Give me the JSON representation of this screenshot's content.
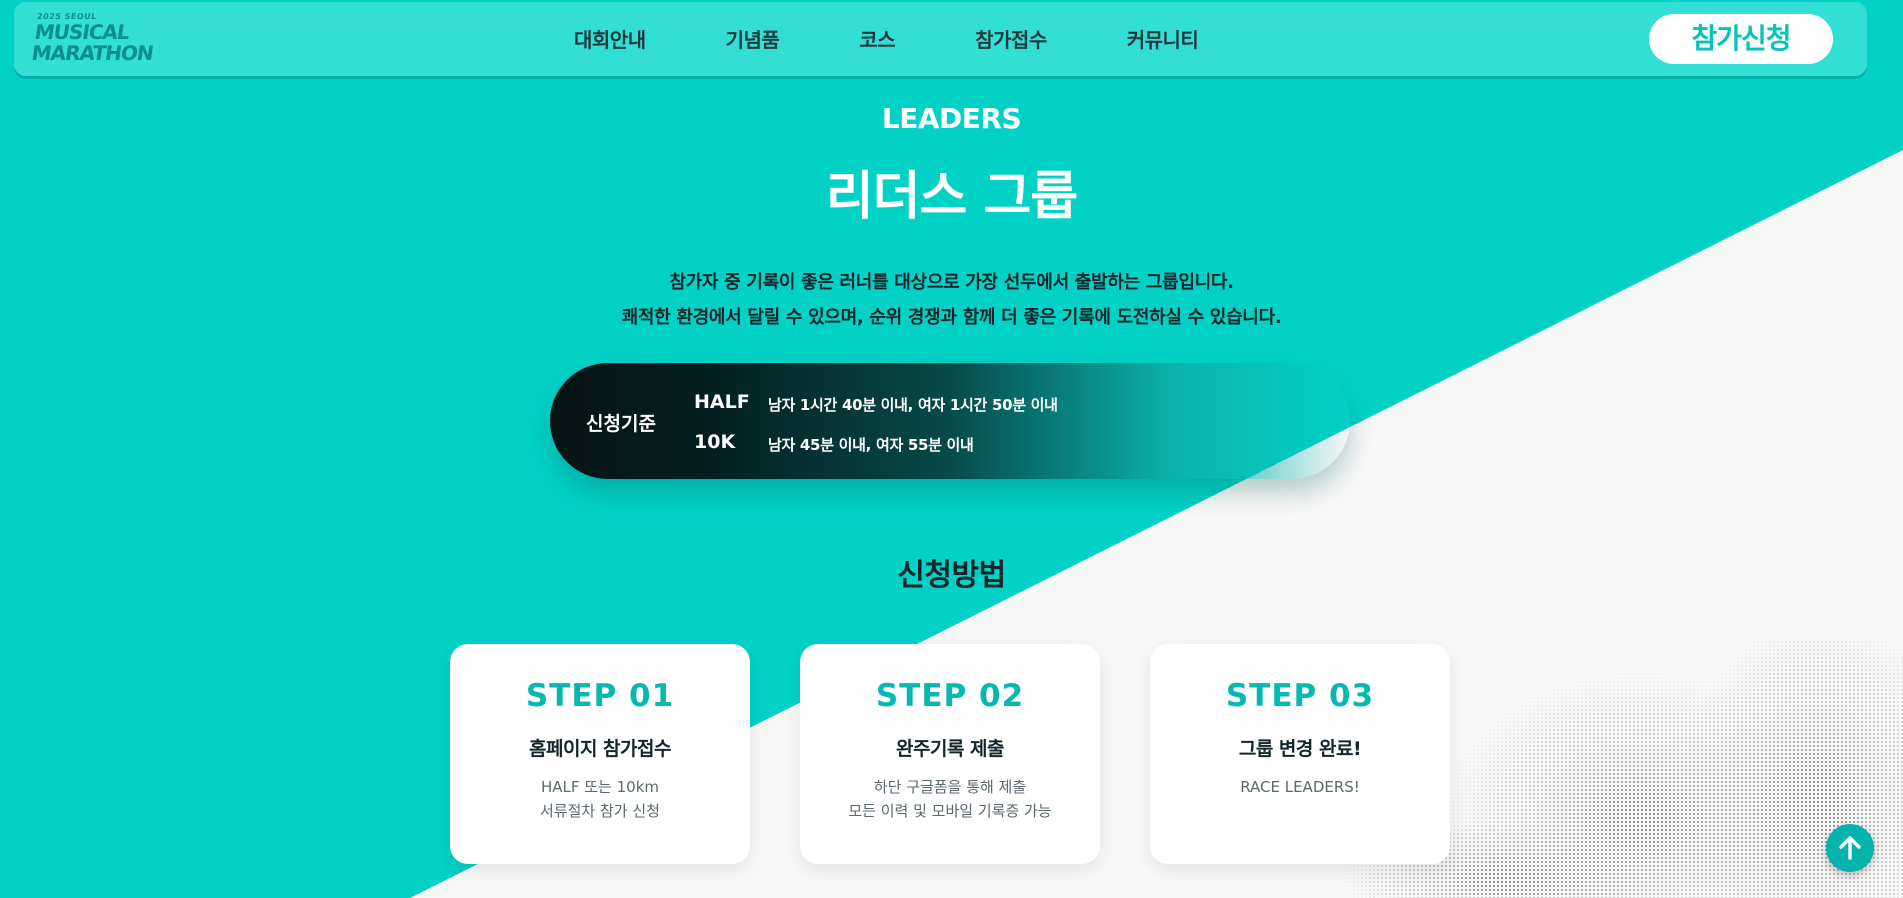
{
  "logo": {
    "line1": "2025 SEOUL",
    "line2": "MUSICAL",
    "line3": "MARATHON"
  },
  "nav": {
    "items": [
      "대회안내",
      "기념품",
      "코스",
      "참가접수",
      "커뮤니티"
    ]
  },
  "header": {
    "apply_label": "참가신청"
  },
  "hero": {
    "eyebrow": "LEADERS",
    "title": "리더스 그룹",
    "desc_line1": "참가자 중 기록이 좋은 러너를 대상으로 가장 선두에서 출발하는 그룹입니다.",
    "desc_line2": "쾌적한 환경에서 달릴 수 있으며, 순위 경쟁과 함께 더 좋은 기록에 도전하실 수 있습니다."
  },
  "criteria": {
    "label": "신청기준",
    "rows": [
      {
        "key": "HALF",
        "value": "남자 1시간 40분 이내, 여자 1시간 50분 이내"
      },
      {
        "key": "10K",
        "value": "남자 45분 이내, 여자 55분 이내"
      }
    ]
  },
  "method": {
    "title": "신청방법",
    "steps": [
      {
        "no": "STEP 01",
        "name": "홈페이지 참가접수",
        "desc1": "HALF 또는 10km",
        "desc2": "서류절차 참가 신청"
      },
      {
        "no": "STEP 02",
        "name": "완주기록 제출",
        "desc1": "하단 구글폼을 통해 제출",
        "desc2": "모든 이력 및 모바일 기록증 가능"
      },
      {
        "no": "STEP 03",
        "name": "그룹 변경 완료!",
        "desc1": "RACE LEADERS!",
        "desc2": ""
      }
    ]
  },
  "icons": {
    "scroll_top": "arrow-up-icon"
  },
  "colors": {
    "accent": "#02d1c6",
    "step_text": "#06b9b0",
    "dark_text": "#14262b"
  }
}
